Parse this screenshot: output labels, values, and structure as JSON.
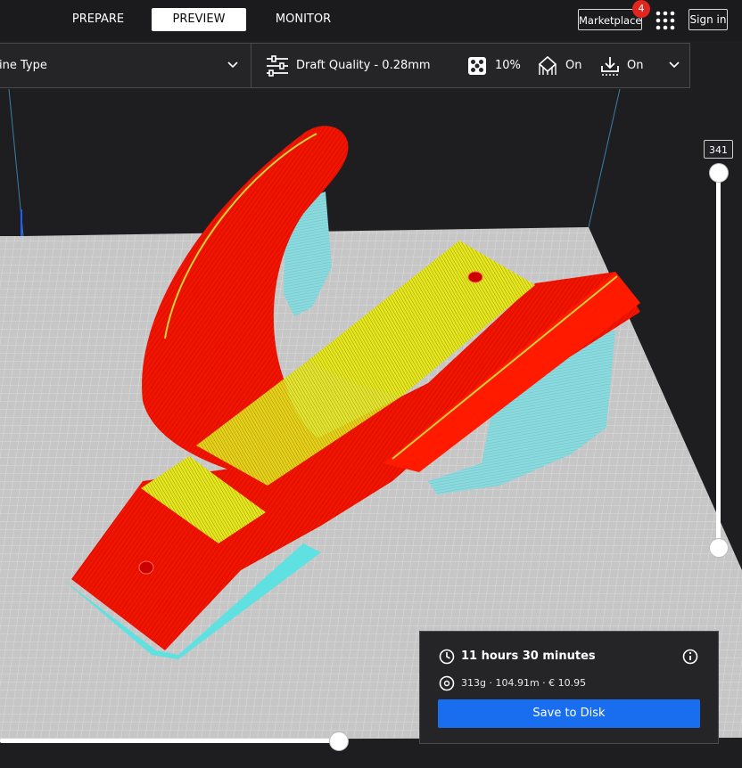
{
  "stages": {
    "prepare": "PREPARE",
    "preview": "PREVIEW",
    "monitor": "MONITOR"
  },
  "header": {
    "marketplace_label": "Marketplace",
    "marketplace_badge": "4",
    "signin_label": "Sign in"
  },
  "view_type": {
    "label": "ine Type"
  },
  "print_settings": {
    "profile": "Draft Quality - 0.28mm",
    "infill": "10%",
    "support": "On",
    "adhesion": "On"
  },
  "layer_slider": {
    "current_layer": "341"
  },
  "print_info": {
    "time": "11 hours 30 minutes",
    "material": "313g · 104.91m · € 10.95",
    "save_label": "Save to Disk"
  },
  "icons": [
    "apps-grid-icon",
    "chevron-down-icon",
    "settings-sliders-icon",
    "infill-icon",
    "support-icon",
    "adhesion-icon",
    "clock-icon",
    "info-icon",
    "spool-icon"
  ],
  "colors": {
    "accent_blue": "#196ef0",
    "model_wall": "#ff1a00",
    "model_top": "#e6e619",
    "support": "#5fe1e1",
    "build_plate": "#c8c8c8",
    "badge_red": "#e0261e"
  }
}
